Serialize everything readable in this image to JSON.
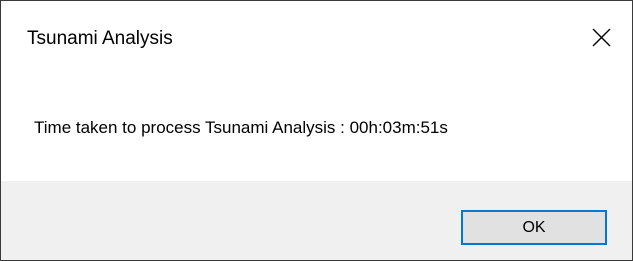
{
  "dialog": {
    "title": "Tsunami Analysis",
    "close_icon": "close-icon",
    "message": "Time taken to process Tsunami Analysis : 00h:03m:51s",
    "ok_label": "OK"
  },
  "colors": {
    "footer_background": "#f0f0f0",
    "button_background": "#e1e1e1",
    "button_focus_border": "#0078d7",
    "dialog_border": "#3a3a3a"
  }
}
